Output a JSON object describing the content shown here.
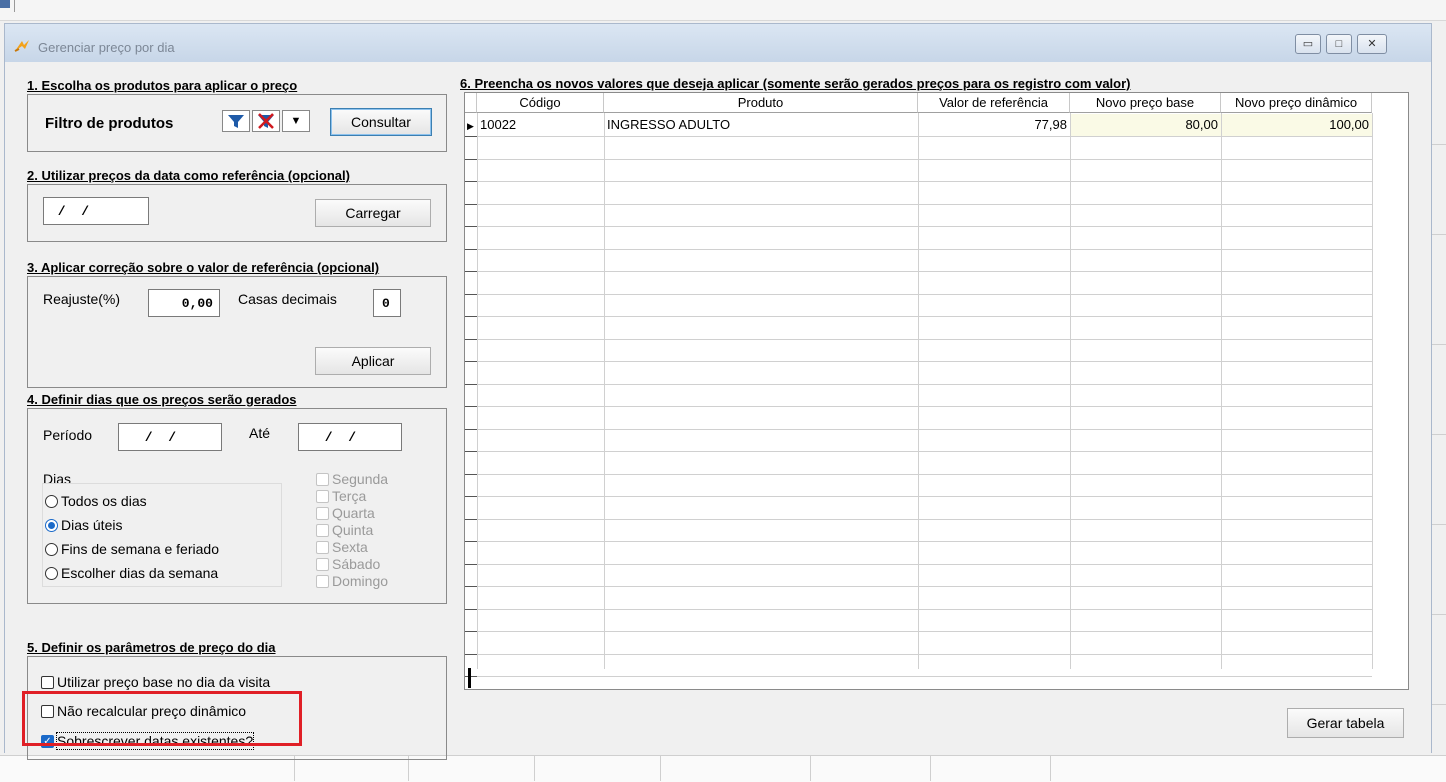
{
  "window": {
    "title": "Gerenciar preço por dia",
    "min_icon": "minimize-icon",
    "max_icon": "maximize-icon",
    "close_icon": "close-icon"
  },
  "section1": {
    "title": "1. Escolha os produtos para aplicar o preço",
    "filter_label": "Filtro de produtos",
    "consultar_label": "Consultar"
  },
  "section2": {
    "title": "2. Utilizar preços da data como referência (opcional)",
    "date_value": " /  /",
    "carregar_label": "Carregar"
  },
  "section3": {
    "title": "3. Aplicar correção sobre o valor de referência (opcional)",
    "reajuste_label": "Reajuste(%)",
    "reajuste_value": "0,00",
    "casas_label": "Casas decimais",
    "casas_value": "0",
    "aplicar_label": "Aplicar"
  },
  "section4": {
    "title": "4. Definir dias que os preços serão gerados",
    "periodo_label": "Período",
    "periodo_value": " /  /",
    "ate_label": "Até",
    "ate_value": " /  /",
    "dias_label": "Dias",
    "options": [
      "Todos os dias",
      "Dias úteis",
      "Fins de semana e feriado",
      "Escolher dias da semana"
    ],
    "selected": "Dias úteis",
    "weekdays": [
      "Segunda",
      "Terça",
      "Quarta",
      "Quinta",
      "Sexta",
      "Sábado",
      "Domingo"
    ]
  },
  "section5": {
    "title": "5. Definir os parâmetros de preço do dia",
    "opt1": "Utilizar preço base no dia da visita",
    "opt1_checked": false,
    "opt2": "Não recalcular preço dinâmico",
    "opt2_checked": false,
    "opt3": "Sobrescrever datas existentes?",
    "opt3_checked": true
  },
  "section6": {
    "title": "6. Preencha os novos valores que deseja aplicar (somente serão gerados preços para os registro com valor)",
    "columns": [
      "Código",
      "Produto",
      "Valor de referência",
      "Novo preço base",
      "Novo preço dinâmico"
    ],
    "rows": [
      {
        "codigo": "10022",
        "produto": "INGRESSO ADULTO",
        "valor_referencia": "77,98",
        "novo_preco_base": "80,00",
        "novo_preco_dinamico": "100,00"
      }
    ]
  },
  "gerar_label": "Gerar tabela",
  "colors": {
    "highlight": "#e01f26",
    "accent": "#1b6ac9"
  }
}
